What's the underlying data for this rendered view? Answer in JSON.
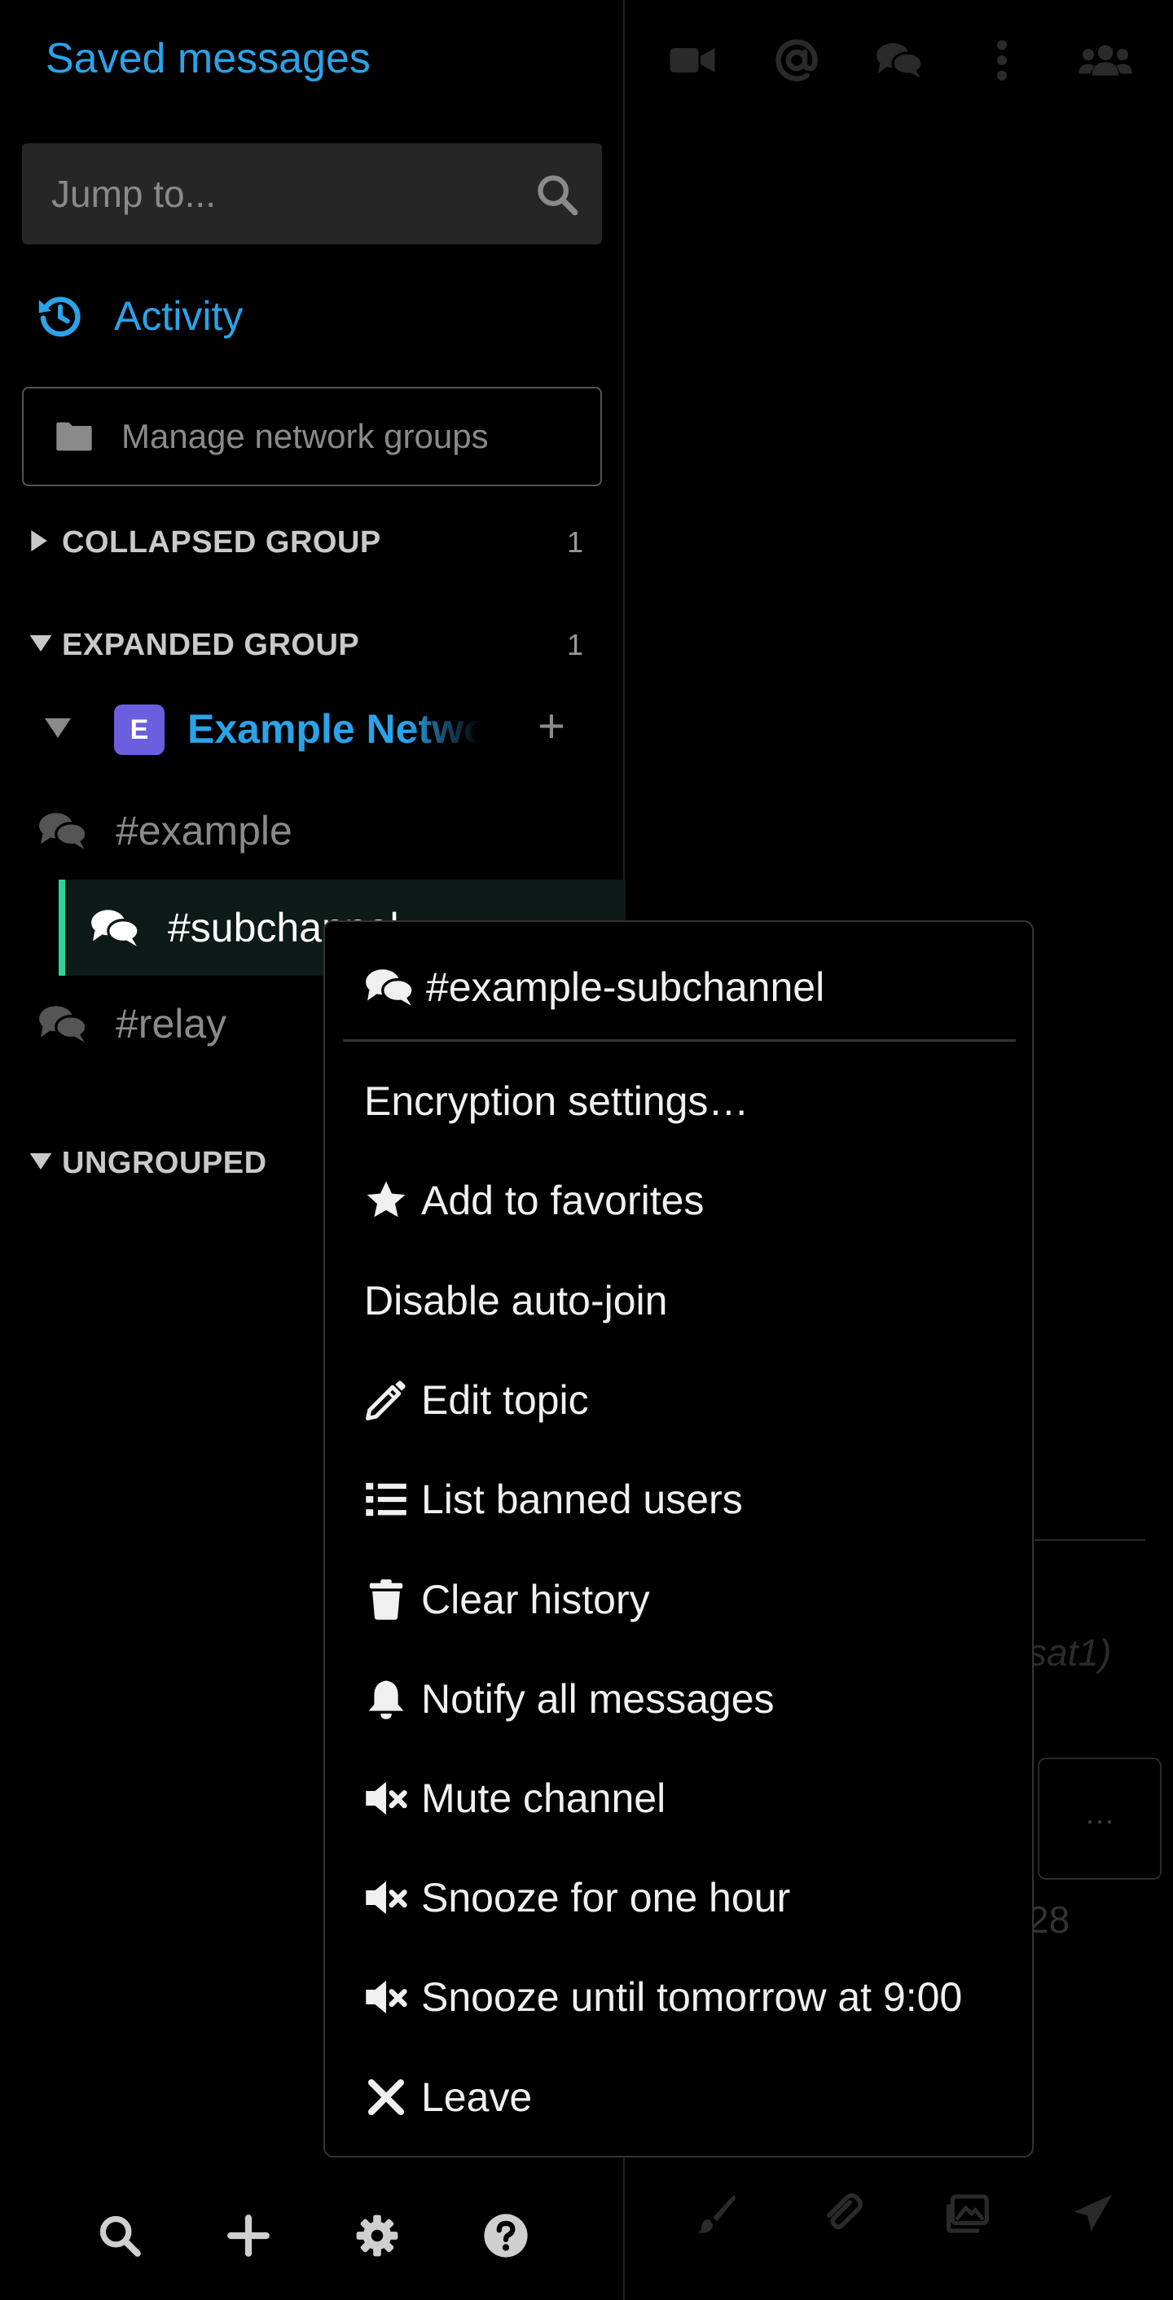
{
  "sidebar": {
    "saved_messages": "Saved messages",
    "jump_placeholder": "Jump to...",
    "activity": "Activity",
    "manage_groups": "Manage network groups",
    "groups": [
      {
        "name": "COLLAPSED GROUP",
        "count": "1",
        "expanded": false
      },
      {
        "name": "EXPANDED GROUP",
        "count": "1",
        "expanded": true
      },
      {
        "name": "UNGROUPED",
        "count": "",
        "expanded": true
      }
    ],
    "network": {
      "initial": "E",
      "name": "Example Network",
      "add": "+"
    },
    "channels": [
      {
        "label": "#example",
        "active": false
      },
      {
        "label": "#subchannel",
        "active": true
      },
      {
        "label": "#relay",
        "active": false
      }
    ]
  },
  "main": {
    "ghost_text": "sat1)",
    "ghost_button": "···",
    "ghost_number": "28"
  },
  "context_menu": {
    "header": "#example-subchannel",
    "items": [
      {
        "label": "Encryption settings…",
        "icon": "none"
      },
      {
        "label": "Add to favorites",
        "icon": "star-icon"
      },
      {
        "label": "Disable auto-join",
        "icon": "none"
      },
      {
        "label": "Edit topic",
        "icon": "pencil-icon"
      },
      {
        "label": "List banned users",
        "icon": "list-icon"
      },
      {
        "label": "Clear history",
        "icon": "trash-icon"
      },
      {
        "label": "Notify all messages",
        "icon": "bell-icon"
      },
      {
        "label": "Mute channel",
        "icon": "mute-icon"
      },
      {
        "label": "Snooze for one hour",
        "icon": "mute-icon"
      },
      {
        "label": "Snooze until tomorrow at 9:00",
        "icon": "mute-icon"
      },
      {
        "label": "Leave",
        "icon": "close-icon"
      }
    ]
  },
  "colors": {
    "accent": "#2aa3e8",
    "active_bar": "#2ed396",
    "avatar": "#6b5fe0",
    "background": "#000000"
  }
}
